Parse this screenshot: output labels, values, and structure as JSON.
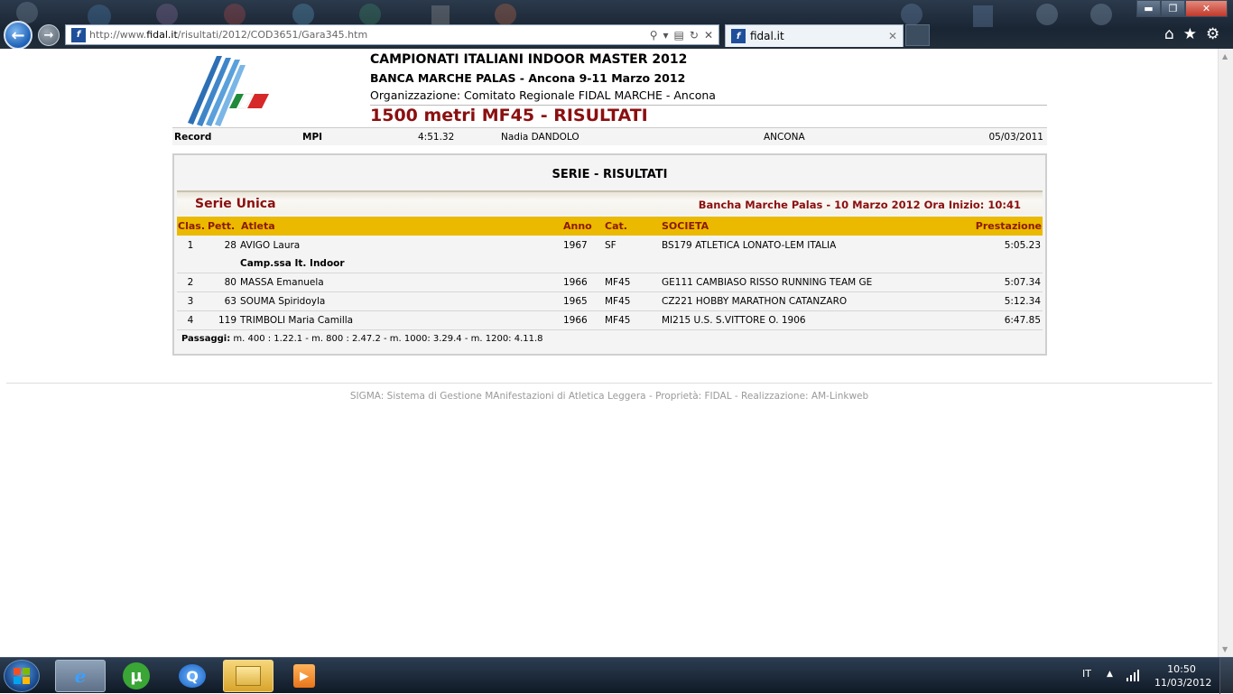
{
  "browser": {
    "url_prefix": "http://www.",
    "url_host": "fidal.it",
    "url_path": "/risultati/2012/COD3651/Gara345.htm",
    "tab_title": "fidal.it"
  },
  "header": {
    "title": "CAMPIONATI ITALIANI INDOOR MASTER 2012",
    "venue": "BANCA MARCHE PALAS - Ancona 9-11 Marzo 2012",
    "organization": "Organizzazione: Comitato Regionale FIDAL MARCHE - Ancona",
    "race_title": "1500 metri MF45 - RISULTATI"
  },
  "record": {
    "label": "Record",
    "type": "MPI",
    "time": "4:51.32",
    "athlete": "Nadia DANDOLO",
    "place": "ANCONA",
    "date": "05/03/2011"
  },
  "results": {
    "section_title": "SERIE - RISULTATI",
    "serie_name": "Serie Unica",
    "serie_info": "Bancha Marche Palas - 10 Marzo 2012 Ora Inizio: 10:41",
    "columns": {
      "clas": "Clas.",
      "pett": "Pett.",
      "atleta": "Atleta",
      "anno": "Anno",
      "cat": "Cat.",
      "societa": "SOCIETA",
      "prestazione": "Prestazione"
    },
    "rows": [
      {
        "clas": "1",
        "pett": "28",
        "atleta": "AVIGO Laura",
        "anno": "1967",
        "cat": "SF",
        "societa": "BS179 ATLETICA LONATO-LEM ITALIA",
        "prestazione": "5:05.23",
        "note": "Camp.ssa It. Indoor"
      },
      {
        "clas": "2",
        "pett": "80",
        "atleta": "MASSA Emanuela",
        "anno": "1966",
        "cat": "MF45",
        "societa": "GE111 CAMBIASO RISSO RUNNING TEAM GE",
        "prestazione": "5:07.34"
      },
      {
        "clas": "3",
        "pett": "63",
        "atleta": "SOUMA Spiridoyla",
        "anno": "1965",
        "cat": "MF45",
        "societa": "CZ221 HOBBY MARATHON CATANZARO",
        "prestazione": "5:12.34"
      },
      {
        "clas": "4",
        "pett": "119",
        "atleta": "TRIMBOLI Maria Camilla",
        "anno": "1966",
        "cat": "MF45",
        "societa": "MI215 U.S. S.VITTORE O. 1906",
        "prestazione": "6:47.85"
      }
    ],
    "passaggi_label": "Passaggi:",
    "passaggi_text": " m. 400 : 1.22.1 - m. 800 : 2.47.2 - m. 1000: 3.29.4 - m. 1200: 4.11.8"
  },
  "footer": {
    "text": "SIGMA: Sistema di Gestione MAnifestazioni di Atletica Leggera - Proprietà: FIDAL - Realizzazione: AM-Linkweb"
  },
  "taskbar": {
    "language": "IT",
    "time": "10:50",
    "date": "11/03/2012"
  },
  "colors": {
    "race_title": "#8b0f0f",
    "table_header_bg": "#eab900",
    "table_header_text": "#8b1a00"
  }
}
